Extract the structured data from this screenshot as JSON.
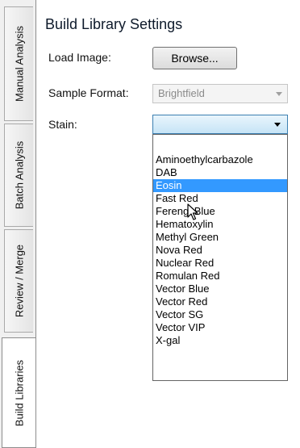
{
  "tabs": [
    {
      "label": "Manual Analysis"
    },
    {
      "label": "Batch Analysis"
    },
    {
      "label": "Review / Merge"
    },
    {
      "label": "Build Libraries"
    }
  ],
  "heading": "Build Library Settings",
  "load_image": {
    "label": "Load Image:",
    "button": "Browse..."
  },
  "sample_format": {
    "label": "Sample Format:",
    "value": "Brightfield"
  },
  "stain": {
    "label": "Stain:",
    "value": "",
    "options": [
      "Aminoethylcarbazole",
      "DAB",
      "Eosin",
      "Fast Red",
      "Ferengi Blue",
      "Hematoxylin",
      "Methyl Green",
      "Nova Red",
      "Nuclear Red",
      "Romulan Red",
      "Vector Blue",
      "Vector Red",
      "Vector SG",
      "Vector VIP",
      "X-gal"
    ],
    "highlighted": "Eosin"
  }
}
